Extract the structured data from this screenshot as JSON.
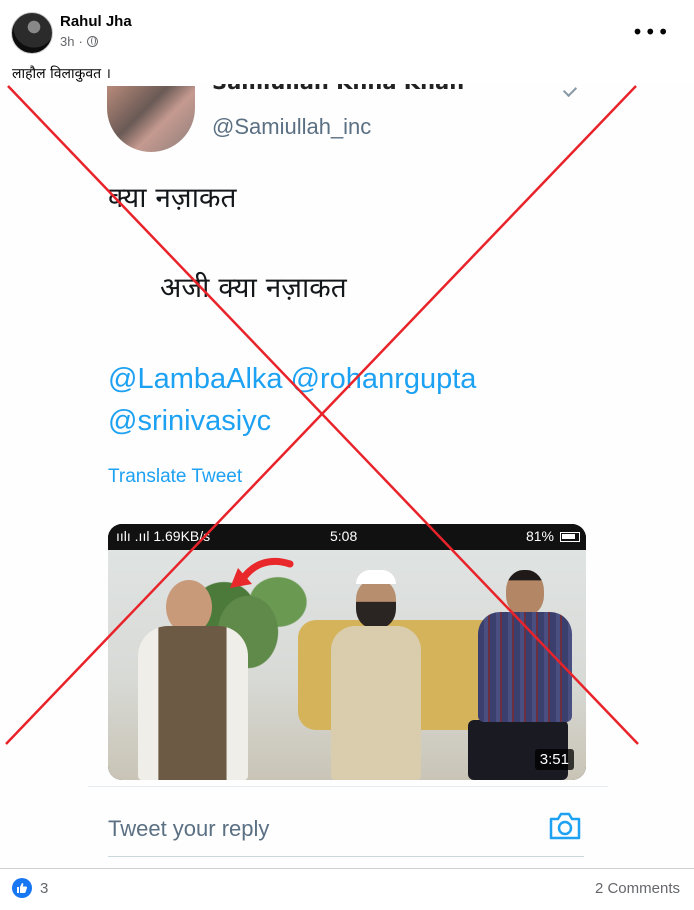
{
  "post": {
    "author": "Rahul Jha",
    "time": "3h",
    "separator": "·",
    "caption": "लाहौल विलाकुवत ।",
    "more_label": "•••"
  },
  "tweet": {
    "name_cut": "Samiullah Khna Khan",
    "handle": "@Samiullah_inc",
    "line1": "क्या नज़ाकत",
    "line2": "अजी क्या नज़ाकत",
    "mention_line1": "@LambaAlka @rohanrgupta",
    "mention_line2": "@srinivasiyc",
    "translate": "Translate Tweet",
    "video": {
      "status_left": "ıılı .ııl 1.69KB/s",
      "status_time": "5:08",
      "status_battery": "81%",
      "duration": "3:51"
    },
    "reply_placeholder": "Tweet your reply"
  },
  "footer": {
    "reactions_count": "3",
    "comments": "2 Comments"
  },
  "colors": {
    "twitter_blue": "#1da1f2",
    "facebook_blue": "#1877f2",
    "cross_red": "#e8232a"
  },
  "icons": [
    "globe-icon",
    "more-icon",
    "camera-icon",
    "like-icon",
    "red-arrow-icon"
  ]
}
